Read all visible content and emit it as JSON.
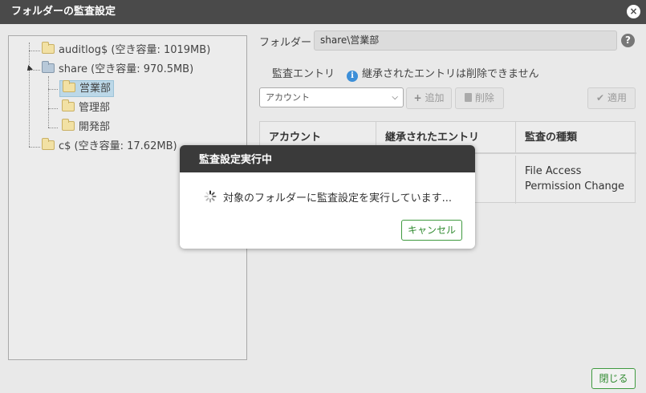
{
  "window": {
    "title": "フォルダーの監査設定",
    "close_icon": "×"
  },
  "tree": {
    "nodes": [
      {
        "label": "auditlog$ (空き容量: 1019MB)"
      },
      {
        "label": "share (空き容量: 970.5MB)"
      },
      {
        "label": "営業部"
      },
      {
        "label": "管理部"
      },
      {
        "label": "開発部"
      },
      {
        "label": "c$ (空き容量: 17.62MB)"
      }
    ]
  },
  "form": {
    "folder_label": "フォルダー",
    "folder_value": "share\\営業部",
    "help_icon": "?",
    "entries_label": "監査エントリ",
    "info_icon": "i",
    "info_text": "継承されたエントリは削除できません",
    "account_select": {
      "value": "アカウント"
    },
    "add_button": "追加",
    "delete_button": "削除",
    "apply_button": "適用"
  },
  "grid": {
    "columns": [
      "アカウント",
      "継承されたエントリ",
      "監査の種類"
    ],
    "row": {
      "audit_type_line1": "File Access",
      "audit_type_line2": "Permission Change"
    }
  },
  "modal": {
    "title": "監査設定実行中",
    "message": "対象のフォルダーに監査設定を実行しています...",
    "cancel_button": "キャンセル"
  },
  "footer": {
    "close_button": "閉じる"
  }
}
